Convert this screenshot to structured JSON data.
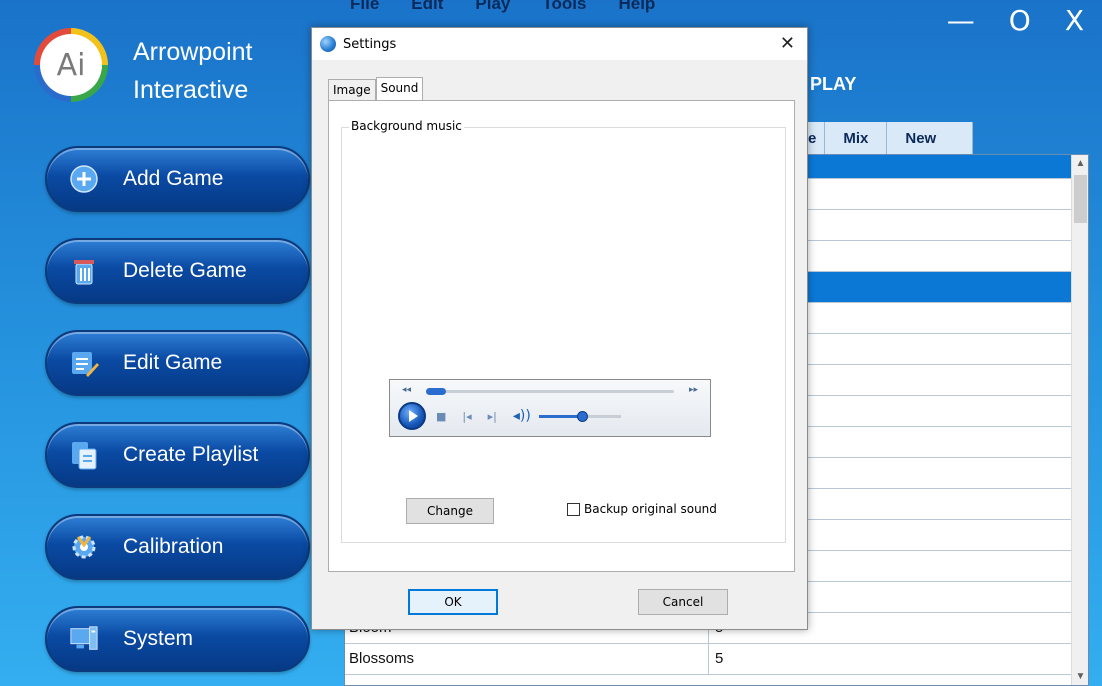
{
  "brand": {
    "line1": "Arrowpoint",
    "line2": "Interactive",
    "logo_text": "Ai"
  },
  "menu": [
    "File",
    "Edit",
    "Play",
    "Tools",
    "Help"
  ],
  "window_controls": {
    "minimize": "—",
    "maximize": "O",
    "close": "X"
  },
  "nav": [
    {
      "label": "Add Game",
      "icon": "plus-circle-icon"
    },
    {
      "label": "Delete Game",
      "icon": "trash-icon"
    },
    {
      "label": "Edit Game",
      "icon": "edit-list-icon"
    },
    {
      "label": "Create Playlist",
      "icon": "playlist-icon"
    },
    {
      "label": "Calibration",
      "icon": "gear-icon"
    },
    {
      "label": "System",
      "icon": "system-icon"
    }
  ],
  "main": {
    "title_partial": "PLAY",
    "tabs": [
      "e",
      "Mix",
      "New"
    ],
    "rows": [
      {
        "name": "Bloom",
        "value": "5"
      },
      {
        "name": "Blossoms",
        "value": "5"
      }
    ]
  },
  "dialog": {
    "title": "Settings",
    "close": "✕",
    "tabs": [
      "Image",
      "Sound"
    ],
    "active_tab": "Sound",
    "group_label": "Background music",
    "player": {
      "seek_back": "◂◂",
      "seek_fwd": "▸▸",
      "progress": 0.08,
      "volume": 0.52
    },
    "change_button": "Change",
    "backup_checkbox": "Backup original sound",
    "backup_checked": false,
    "ok_button": "OK",
    "cancel_button": "Cancel"
  },
  "colors": {
    "accent": "#0078d7",
    "selected_row": "#0c78d6",
    "nav_button": "#0a4aa3"
  }
}
